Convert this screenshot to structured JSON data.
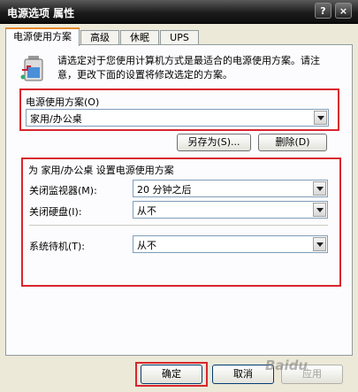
{
  "window": {
    "title": "电源选项 属性"
  },
  "titlebar": {
    "help_label": "?",
    "close_label": "×"
  },
  "tabs": [
    {
      "label": "电源使用方案"
    },
    {
      "label": "高级"
    },
    {
      "label": "休眠"
    },
    {
      "label": "UPS"
    }
  ],
  "description": "请选定对于您使用计算机方式是最适合的电源使用方案。请注意，更改下面的设置将修改选定的方案。",
  "scheme": {
    "group_label": "电源使用方案(O)",
    "selected": "家用/办公桌",
    "save_as_label": "另存为(S)...",
    "delete_label": "删除(D)"
  },
  "settings": {
    "group_label": "为 家用/办公桌 设置电源使用方案",
    "monitor_label": "关闭监视器(M):",
    "monitor_value": "20 分钟之后",
    "harddisk_label": "关闭硬盘(I):",
    "harddisk_value": "从不",
    "standby_label": "系统待机(T):",
    "standby_value": "从不"
  },
  "footer": {
    "ok_label": "确定",
    "cancel_label": "取消",
    "apply_label": "应用"
  },
  "watermark": "Baidu",
  "colors": {
    "highlight_frame": "#d8262e",
    "tab_accent": "#e68b2c"
  }
}
